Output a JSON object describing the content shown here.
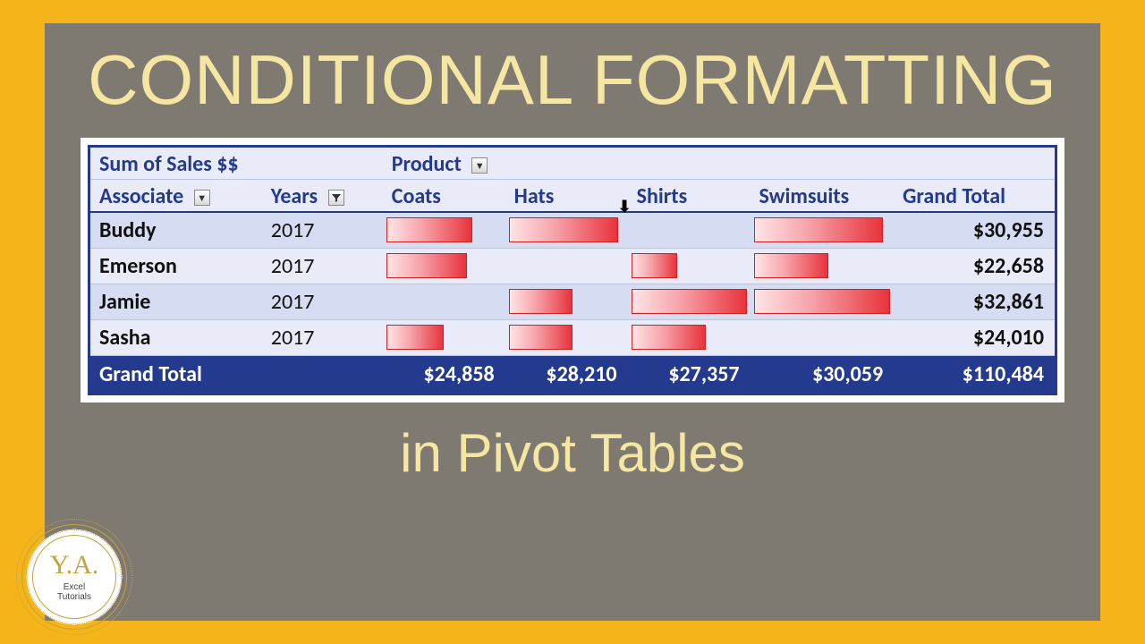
{
  "title": "CONDITIONAL FORMATTING",
  "subtitle": "in Pivot Tables",
  "logo": {
    "initials": "Y.A.",
    "line1": "Excel",
    "line2": "Tutorials"
  },
  "pivot": {
    "measure_label": "Sum of Sales $$",
    "col_field_label": "Product",
    "row_field_label": "Associate",
    "year_label": "Years",
    "grand_total_label": "Grand Total",
    "columns": [
      "Coats",
      "Hats",
      "Shirts",
      "Swimsuits"
    ],
    "rows": [
      {
        "name": "Buddy",
        "year": "2017",
        "bars": [
          75,
          95,
          0,
          95
        ],
        "total": "$30,955"
      },
      {
        "name": "Emerson",
        "year": "2017",
        "bars": [
          70,
          0,
          40,
          55
        ],
        "total": "$22,658"
      },
      {
        "name": "Jamie",
        "year": "2017",
        "bars": [
          0,
          55,
          100,
          100
        ],
        "total": "$32,861"
      },
      {
        "name": "Sasha",
        "year": "2017",
        "bars": [
          50,
          55,
          65,
          0
        ],
        "total": "$24,010"
      }
    ],
    "col_totals": [
      "$24,858",
      "$28,210",
      "$27,357",
      "$30,059"
    ],
    "grand_total": "$110,484"
  }
}
